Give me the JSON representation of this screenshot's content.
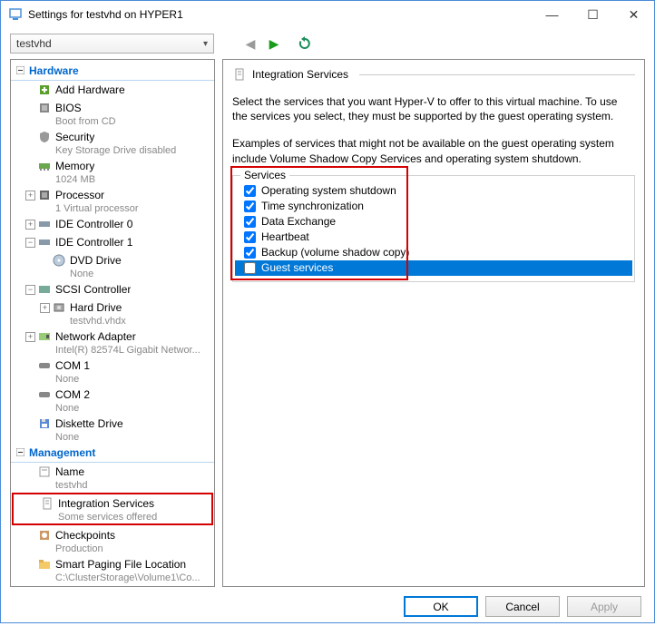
{
  "window": {
    "title": "Settings for testvhd on HYPER1"
  },
  "toolbar": {
    "vm_selected": "testvhd"
  },
  "tree": {
    "hardware_header": "Hardware",
    "management_header": "Management",
    "items": {
      "add_hardware": "Add Hardware",
      "bios": "BIOS",
      "bios_sub": "Boot from CD",
      "security": "Security",
      "security_sub": "Key Storage Drive disabled",
      "memory": "Memory",
      "memory_sub": "1024 MB",
      "processor": "Processor",
      "processor_sub": "1 Virtual processor",
      "ide0": "IDE Controller 0",
      "ide1": "IDE Controller 1",
      "dvd": "DVD Drive",
      "dvd_sub": "None",
      "scsi": "SCSI Controller",
      "hdd": "Hard Drive",
      "hdd_sub": "testvhd.vhdx",
      "net": "Network Adapter",
      "net_sub": "Intel(R) 82574L Gigabit Networ...",
      "com1": "COM 1",
      "com1_sub": "None",
      "com2": "COM 2",
      "com2_sub": "None",
      "diskette": "Diskette Drive",
      "diskette_sub": "None",
      "name": "Name",
      "name_sub": "testvhd",
      "integration": "Integration Services",
      "integration_sub": "Some services offered",
      "checkpoints": "Checkpoints",
      "checkpoints_sub": "Production",
      "paging": "Smart Paging File Location",
      "paging_sub": "C:\\ClusterStorage\\Volume1\\Co..."
    }
  },
  "rightpanel": {
    "header": "Integration Services",
    "desc1": "Select the services that you want Hyper-V to offer to this virtual machine. To use the services you select, they must be supported by the guest operating system.",
    "desc2": "Examples of services that might not be available on the guest operating system include Volume Shadow Copy Services and operating system shutdown.",
    "services_label": "Services",
    "services": [
      {
        "label": "Operating system shutdown",
        "checked": true,
        "selected": false
      },
      {
        "label": "Time synchronization",
        "checked": true,
        "selected": false
      },
      {
        "label": "Data Exchange",
        "checked": true,
        "selected": false
      },
      {
        "label": "Heartbeat",
        "checked": true,
        "selected": false
      },
      {
        "label": "Backup (volume shadow copy)",
        "checked": true,
        "selected": false
      },
      {
        "label": "Guest services",
        "checked": false,
        "selected": true
      }
    ]
  },
  "footer": {
    "ok": "OK",
    "cancel": "Cancel",
    "apply": "Apply"
  }
}
